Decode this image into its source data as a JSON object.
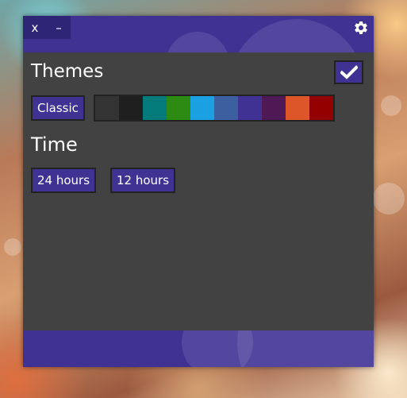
{
  "window": {
    "close_label": "x",
    "minimize_label": "–",
    "settings_icon": "gear-icon"
  },
  "themes": {
    "heading": "Themes",
    "confirm_icon": "checkmark-icon",
    "classic_label": "Classic",
    "swatches": [
      {
        "name": "dark-gray",
        "color": "#333333"
      },
      {
        "name": "black",
        "color": "#1f1f1f"
      },
      {
        "name": "teal",
        "color": "#037b7a"
      },
      {
        "name": "green",
        "color": "#2d8a12"
      },
      {
        "name": "sky-blue",
        "color": "#1ba1e2"
      },
      {
        "name": "steel-blue",
        "color": "#3c5fa0"
      },
      {
        "name": "indigo",
        "color": "#3f3293"
      },
      {
        "name": "plum",
        "color": "#4f1956"
      },
      {
        "name": "orange",
        "color": "#dd5629"
      },
      {
        "name": "red",
        "color": "#940000"
      }
    ]
  },
  "time": {
    "heading": "Time",
    "option_24": "24 hours",
    "option_12": "12 hours"
  },
  "colors": {
    "accent": "#3f3293",
    "window_bg": "#424242",
    "border": "#222222"
  }
}
